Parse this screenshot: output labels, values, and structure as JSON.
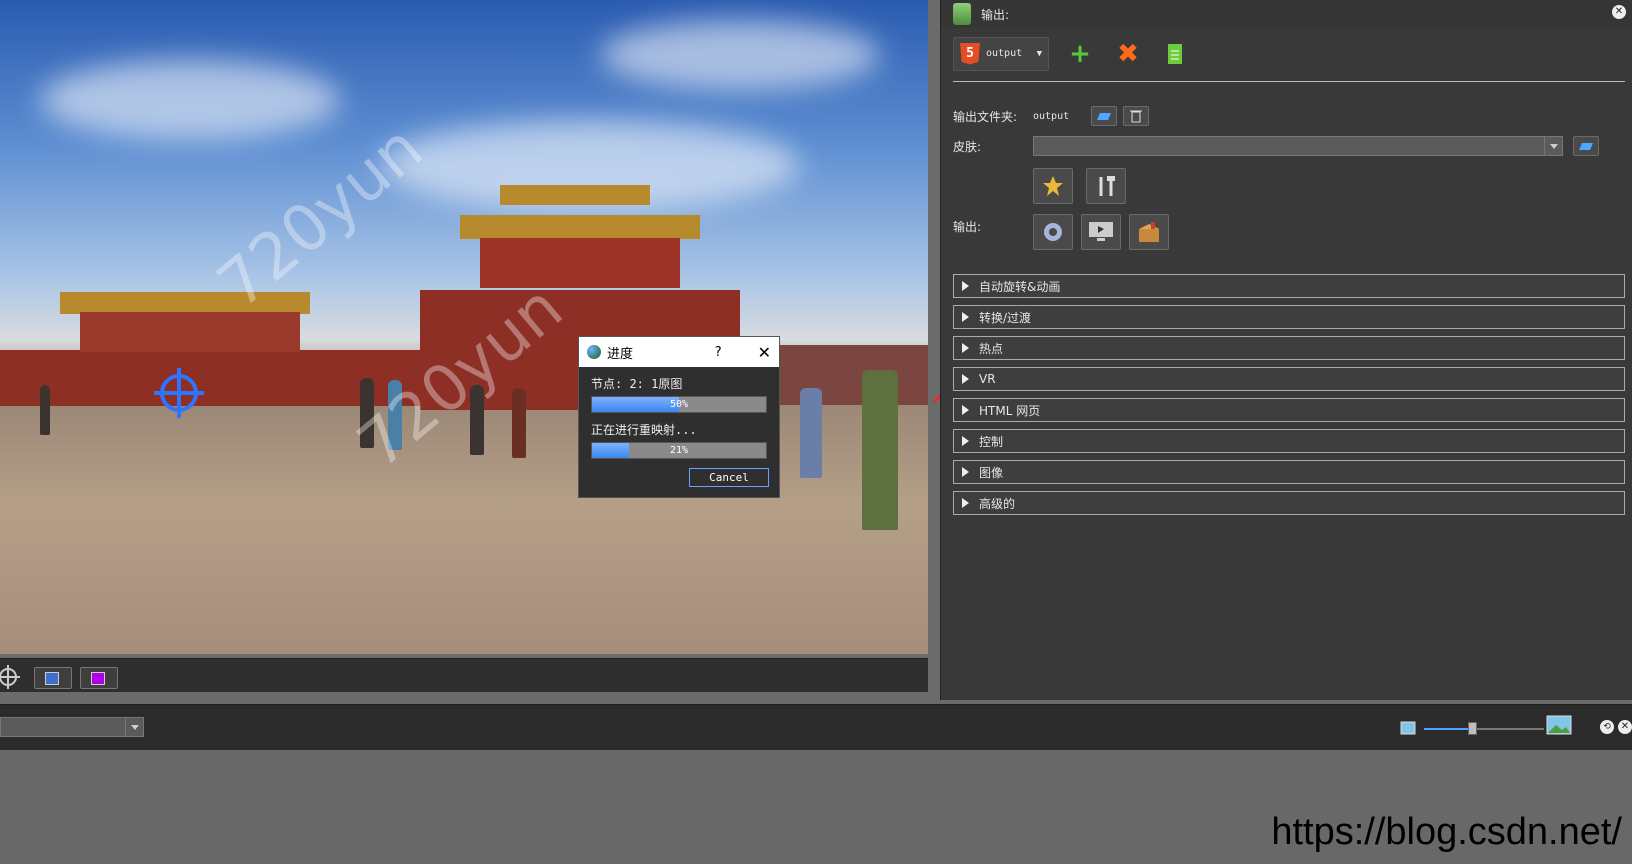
{
  "panel": {
    "title": "输出:",
    "toolbar": {
      "output_label": "output",
      "add_icon": "plus-icon",
      "remove_icon": "remove-icon",
      "document_icon": "document-icon"
    },
    "output_folder_label": "输出文件夹:",
    "output_folder_value": "output",
    "skin_label": "皮肤:",
    "skin_value": "",
    "output_label": "输出:",
    "sections": [
      {
        "label": "自动旋转&动画"
      },
      {
        "label": "转换/过渡"
      },
      {
        "label": "热点"
      },
      {
        "label": "VR"
      },
      {
        "label": "HTML 网页"
      },
      {
        "label": "控制"
      },
      {
        "label": "图像"
      },
      {
        "label": "高级的"
      }
    ]
  },
  "dialog": {
    "title": "进度",
    "help": "?",
    "close": "✕",
    "node_label": "节点: 2: 1原图",
    "node_progress_text": "50%",
    "node_progress": 0.5,
    "task_label": "正在进行重映射...",
    "task_progress_text": "21%",
    "task_progress": 0.21,
    "cancel_label": "Cancel"
  },
  "viewport": {
    "swatch1_color": "#3a6fd0",
    "swatch2_color": "#b000e8",
    "watermark_text": "720yun"
  },
  "bottom": {
    "combo_value": "",
    "zoom_level": 0.4
  },
  "watermark_url": "https://blog.csdn.net/",
  "colors": {
    "accent": "#3a86ef",
    "arrow": "#ff2020"
  }
}
